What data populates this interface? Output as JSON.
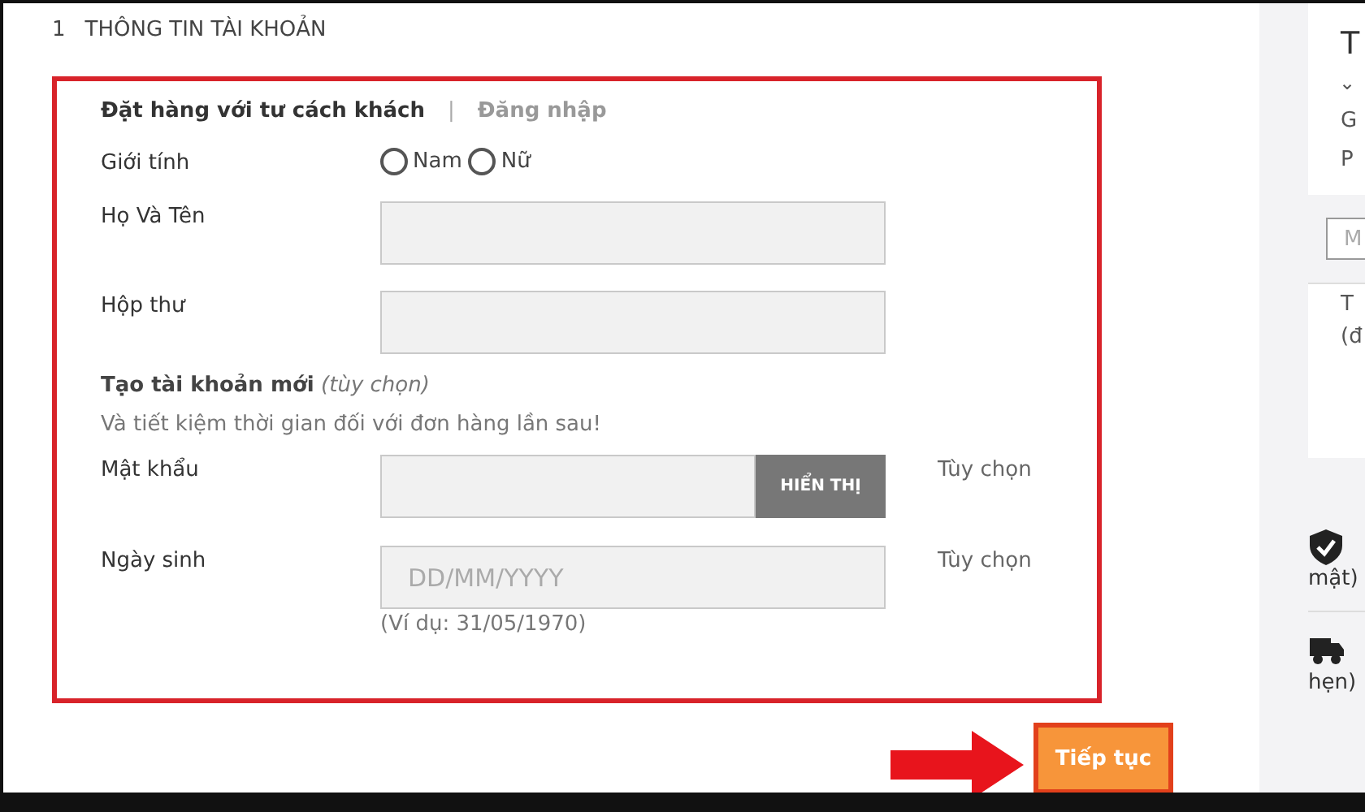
{
  "section": {
    "number": "1",
    "title": "THÔNG TIN TÀI KHOẢN"
  },
  "tabs": [
    {
      "label": "Đặt hàng với tư cách khách",
      "selected": true
    },
    {
      "label": "Đăng nhập",
      "selected": false
    }
  ],
  "tab_separator": "|",
  "gender": {
    "label": "Giới tính",
    "options": [
      {
        "label": "Nam",
        "selected": false
      },
      {
        "label": "Nữ",
        "selected": false
      }
    ]
  },
  "fields": [
    {
      "label": "Họ Và Tên"
    },
    {
      "label": "Hộp thư"
    }
  ],
  "create_account": {
    "title": "**Tạo tài khoản mới** *(tùy chọn)*",
    "text": "Và tiết kiệm thời gian đối với đơn hàng lần sau!"
  },
  "password": {
    "label": "Mật khẩu",
    "button": "HIỂN THỊ",
    "note": "Tùy chọn"
  },
  "birthday": {
    "label": "Ngày sinh",
    "placeholder": "DD/MM/YYYY",
    "example": "(Ví dụ: 31/05/1970)",
    "note": "Tùy chọn"
  },
  "continue_button": "Tiếp tục",
  "summary": {
    "title": "T",
    "chevron": "⌄",
    "lines": [
      "G",
      "P"
    ],
    "code_placeholder": "M",
    "total": [
      "T",
      "(đ"
    ]
  },
  "features": [
    {
      "kind": "shield",
      "text": "mật)"
    },
    {
      "kind": "truck",
      "text": "hẹn)"
    }
  ]
}
